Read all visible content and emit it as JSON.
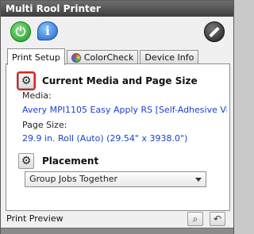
{
  "window": {
    "title": "Multi Rool Printer"
  },
  "toolbar": {
    "power_icon": "power-icon",
    "info_icon": "info-icon",
    "edit_icon": "pen-icon"
  },
  "tabs": [
    {
      "label": "Print Setup",
      "active": true
    },
    {
      "label": "ColorCheck",
      "icon": "colorcheck-icon"
    },
    {
      "label": "Device Info"
    }
  ],
  "media_section": {
    "title": "Current Media and Page Size",
    "media_label": "Media:",
    "media_value": "Avery MPI1105 Easy Apply RS [Self-Adhesive Vi...",
    "page_size_label": "Page Size:",
    "page_size_value": "29.9 in. Roll (Auto) (29.54\" x 3938.0\")"
  },
  "placement_section": {
    "title": "Placement",
    "selected_option": "Group Jobs Together"
  },
  "preview": {
    "label": "Print Preview"
  },
  "colors": {
    "link_blue": "#1a3fd0",
    "highlight_red": "#e02020"
  }
}
